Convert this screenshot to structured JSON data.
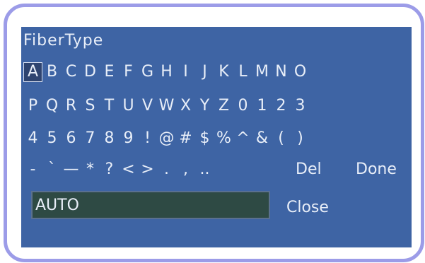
{
  "dialog": {
    "title": "FiberType",
    "rows": [
      [
        "A",
        "B",
        "C",
        "D",
        "E",
        "F",
        "G",
        "H",
        "I",
        "J",
        "K",
        "L",
        "M",
        "N",
        "O"
      ],
      [
        "P",
        "Q",
        "R",
        "S",
        "T",
        "U",
        "V",
        "W",
        "X",
        "Y",
        "Z",
        "0",
        "1",
        "2",
        "3"
      ],
      [
        "4",
        "5",
        "6",
        "7",
        "8",
        "9",
        "!",
        "@",
        "#",
        "$",
        "%",
        "^",
        "&",
        "(",
        ")"
      ],
      [
        "-",
        "`",
        "—",
        "*",
        "?",
        "<",
        ">",
        ".",
        ",",
        ".."
      ]
    ],
    "selected_key": "A",
    "del_label": "Del",
    "done_label": "Done",
    "input_value": "AUTO",
    "close_label": "Close"
  },
  "colors": {
    "panel_background": "#3e64a4",
    "frame_border": "#9c9ce8",
    "input_background": "#2e4a44",
    "text": "#e8eef8"
  }
}
